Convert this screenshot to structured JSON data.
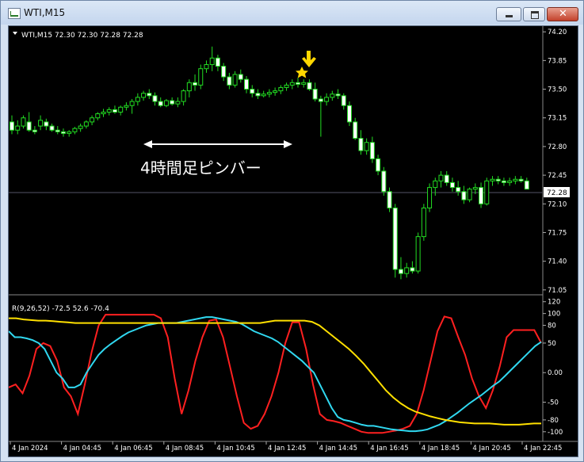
{
  "window": {
    "title": "WTI,M15",
    "icon": "chart-window-icon"
  },
  "price_panel": {
    "header": "WTI,M15  72.30 72.30 72.28 72.28",
    "current_price_tag": "72.28",
    "axis_ticks": [
      "74.20",
      "73.85",
      "73.50",
      "73.15",
      "72.80",
      "72.45",
      "72.10",
      "71.75",
      "71.40",
      "71.05"
    ],
    "annotation": "4時間足ピンバー",
    "marker_colors": {
      "star": "#ffd700",
      "arrow": "#ffd700"
    }
  },
  "indicator_panel": {
    "header": "R(9,26,52) -72.5 52.6 -70.4",
    "axis_ticks": [
      "120",
      "100",
      "80",
      "50",
      "0.00",
      "-50",
      "-80",
      "-100"
    ]
  },
  "time_axis": [
    "4 Jan 2024",
    "4 Jan 04:45",
    "4 Jan 06:45",
    "4 Jan 08:45",
    "4 Jan 10:45",
    "4 Jan 12:45",
    "4 Jan 14:45",
    "4 Jan 16:45",
    "4 Jan 18:45",
    "4 Jan 20:45",
    "4 Jan 22:45"
  ],
  "chart_data": [
    {
      "type": "candlestick",
      "title": "WTI,M15",
      "ylim": [
        71.0,
        74.25
      ],
      "candles": [
        [
          73.1,
          73.18,
          72.95,
          73.0
        ],
        [
          73.0,
          73.12,
          72.95,
          73.05
        ],
        [
          73.05,
          73.18,
          73.02,
          73.15
        ],
        [
          73.1,
          73.22,
          72.98,
          73.0
        ],
        [
          73.0,
          73.05,
          72.95,
          72.98
        ],
        [
          73.05,
          73.18,
          73.0,
          73.12
        ],
        [
          73.1,
          73.14,
          73.0,
          73.05
        ],
        [
          73.05,
          73.08,
          72.98,
          73.0
        ],
        [
          73.0,
          73.05,
          72.95,
          72.98
        ],
        [
          72.98,
          73.02,
          72.92,
          72.96
        ],
        [
          72.96,
          73.0,
          72.92,
          72.98
        ],
        [
          72.98,
          73.04,
          72.95,
          73.02
        ],
        [
          73.02,
          73.08,
          72.98,
          73.05
        ],
        [
          73.05,
          73.12,
          73.02,
          73.1
        ],
        [
          73.1,
          73.18,
          73.06,
          73.15
        ],
        [
          73.15,
          73.22,
          73.12,
          73.2
        ],
        [
          73.2,
          73.26,
          73.16,
          73.22
        ],
        [
          73.22,
          73.28,
          73.18,
          73.25
        ],
        [
          73.25,
          73.3,
          73.2,
          73.22
        ],
        [
          73.22,
          73.3,
          73.18,
          73.28
        ],
        [
          73.28,
          73.34,
          73.24,
          73.3
        ],
        [
          73.3,
          73.38,
          73.2,
          73.35
        ],
        [
          73.35,
          73.45,
          73.3,
          73.4
        ],
        [
          73.4,
          73.48,
          73.36,
          73.45
        ],
        [
          73.45,
          73.5,
          73.38,
          73.42
        ],
        [
          73.42,
          73.46,
          73.3,
          73.35
        ],
        [
          73.35,
          73.4,
          73.28,
          73.3
        ],
        [
          73.3,
          73.38,
          73.28,
          73.36
        ],
        [
          73.36,
          73.4,
          73.3,
          73.32
        ],
        [
          73.32,
          73.4,
          73.28,
          73.35
        ],
        [
          73.35,
          73.5,
          73.3,
          73.48
        ],
        [
          73.48,
          73.62,
          73.4,
          73.58
        ],
        [
          73.58,
          73.68,
          73.48,
          73.55
        ],
        [
          73.55,
          73.8,
          73.5,
          73.75
        ],
        [
          73.75,
          73.85,
          73.7,
          73.8
        ],
        [
          73.8,
          74.02,
          73.72,
          73.88
        ],
        [
          73.88,
          73.92,
          73.72,
          73.78
        ],
        [
          73.78,
          73.82,
          73.6,
          73.65
        ],
        [
          73.65,
          73.7,
          73.5,
          73.55
        ],
        [
          73.55,
          73.72,
          73.52,
          73.68
        ],
        [
          73.68,
          73.74,
          73.58,
          73.62
        ],
        [
          73.62,
          73.66,
          73.45,
          73.5
        ],
        [
          73.5,
          73.55,
          73.4,
          73.45
        ],
        [
          73.45,
          73.5,
          73.38,
          73.42
        ],
        [
          73.42,
          73.48,
          73.4,
          73.44
        ],
        [
          73.44,
          73.5,
          73.4,
          73.46
        ],
        [
          73.46,
          73.52,
          73.42,
          73.48
        ],
        [
          73.48,
          73.55,
          73.44,
          73.52
        ],
        [
          73.52,
          73.58,
          73.48,
          73.55
        ],
        [
          73.55,
          73.62,
          73.5,
          73.58
        ],
        [
          73.58,
          73.64,
          73.52,
          73.56
        ],
        [
          73.56,
          73.62,
          73.52,
          73.58
        ],
        [
          73.58,
          73.62,
          73.48,
          73.5
        ],
        [
          73.5,
          73.58,
          73.35,
          73.38
        ],
        [
          73.38,
          73.42,
          72.92,
          73.35
        ],
        [
          73.35,
          73.45,
          73.3,
          73.4
        ],
        [
          73.4,
          73.48,
          73.36,
          73.44
        ],
        [
          73.44,
          73.5,
          73.38,
          73.42
        ],
        [
          73.42,
          73.45,
          73.25,
          73.3
        ],
        [
          73.3,
          73.35,
          73.05,
          73.1
        ],
        [
          73.1,
          73.15,
          72.88,
          72.9
        ],
        [
          72.9,
          73.0,
          72.7,
          72.75
        ],
        [
          72.75,
          72.9,
          72.7,
          72.85
        ],
        [
          72.85,
          72.92,
          72.6,
          72.65
        ],
        [
          72.65,
          72.7,
          72.45,
          72.5
        ],
        [
          72.5,
          72.55,
          72.2,
          72.25
        ],
        [
          72.25,
          72.3,
          72.0,
          72.05
        ],
        [
          72.05,
          72.1,
          71.2,
          71.3
        ],
        [
          71.3,
          71.45,
          71.18,
          71.25
        ],
        [
          71.25,
          71.38,
          71.2,
          71.32
        ],
        [
          71.32,
          71.4,
          71.25,
          71.28
        ],
        [
          71.28,
          71.75,
          71.25,
          71.7
        ],
        [
          71.7,
          72.1,
          71.65,
          72.05
        ],
        [
          72.05,
          72.35,
          72.0,
          72.3
        ],
        [
          72.3,
          72.42,
          72.2,
          72.38
        ],
        [
          72.38,
          72.5,
          72.3,
          72.45
        ],
        [
          72.45,
          72.5,
          72.32,
          72.36
        ],
        [
          72.36,
          72.42,
          72.25,
          72.3
        ],
        [
          72.3,
          72.38,
          72.2,
          72.25
        ],
        [
          72.25,
          72.32,
          72.1,
          72.15
        ],
        [
          72.15,
          72.3,
          72.12,
          72.28
        ],
        [
          72.28,
          72.35,
          72.22,
          72.3
        ],
        [
          72.3,
          72.36,
          72.05,
          72.1
        ],
        [
          72.1,
          72.42,
          72.08,
          72.38
        ],
        [
          72.38,
          72.44,
          72.32,
          72.4
        ],
        [
          72.4,
          72.44,
          72.34,
          72.38
        ],
        [
          72.38,
          72.42,
          72.32,
          72.36
        ],
        [
          72.36,
          72.42,
          72.32,
          72.38
        ],
        [
          72.38,
          72.44,
          72.34,
          72.4
        ],
        [
          72.4,
          72.44,
          72.36,
          72.38
        ],
        [
          72.38,
          72.42,
          72.3,
          72.28
        ]
      ]
    },
    {
      "type": "line",
      "title": "R(9,26,52) -72.5 52.6 -70.4",
      "ylim": [
        -115,
        125
      ],
      "series": [
        {
          "name": "R9",
          "color": "#ff2020",
          "values": [
            -25,
            -20,
            -35,
            -5,
            40,
            50,
            45,
            20,
            -25,
            -40,
            -70,
            -20,
            35,
            80,
            98,
            98,
            98,
            98,
            98,
            98,
            98,
            98,
            92,
            60,
            -10,
            -70,
            -30,
            20,
            60,
            88,
            90,
            60,
            10,
            -40,
            -85,
            -95,
            -90,
            -70,
            -40,
            0,
            50,
            85,
            85,
            40,
            -20,
            -70,
            -80,
            -82,
            -85,
            -90,
            -95,
            -100,
            -102,
            -102,
            -102,
            -100,
            -98,
            -95,
            -90,
            -70,
            -30,
            20,
            70,
            95,
            92,
            60,
            30,
            -10,
            -40,
            -60,
            -30,
            10,
            60,
            72,
            72,
            72,
            72,
            50
          ]
        },
        {
          "name": "R26",
          "color": "#30d8f0",
          "values": [
            70,
            60,
            60,
            58,
            55,
            50,
            40,
            20,
            0,
            -10,
            -25,
            -25,
            -20,
            0,
            15,
            30,
            40,
            48,
            55,
            62,
            68,
            72,
            76,
            80,
            82,
            84,
            84,
            84,
            84,
            86,
            88,
            90,
            92,
            94,
            94,
            92,
            90,
            88,
            86,
            82,
            76,
            70,
            66,
            62,
            58,
            52,
            44,
            36,
            28,
            20,
            10,
            0,
            -20,
            -40,
            -60,
            -75,
            -80,
            -82,
            -85,
            -88,
            -90,
            -90,
            -92,
            -94,
            -96,
            -97,
            -98,
            -99,
            -99,
            -98,
            -96,
            -92,
            -88,
            -82,
            -75,
            -68,
            -60,
            -52,
            -45,
            -38,
            -30,
            -22,
            -15,
            -5,
            5,
            15,
            25,
            35,
            45,
            52
          ]
        },
        {
          "name": "R52",
          "color": "#ffe000",
          "values": [
            92,
            92,
            90,
            89,
            88,
            88,
            87,
            86,
            85,
            84,
            84,
            84,
            84,
            84,
            84,
            84,
            84,
            84,
            84,
            84,
            84,
            84,
            84,
            84,
            84,
            84,
            84,
            84,
            84,
            84,
            84,
            84,
            84,
            84,
            84,
            86,
            88,
            88,
            88,
            88,
            88,
            86,
            80,
            70,
            60,
            50,
            40,
            28,
            15,
            0,
            -15,
            -30,
            -42,
            -52,
            -60,
            -66,
            -70,
            -74,
            -77,
            -80,
            -82,
            -84,
            -85,
            -86,
            -86,
            -86,
            -87,
            -88,
            -88,
            -88,
            -87,
            -86,
            -86
          ]
        }
      ]
    }
  ]
}
